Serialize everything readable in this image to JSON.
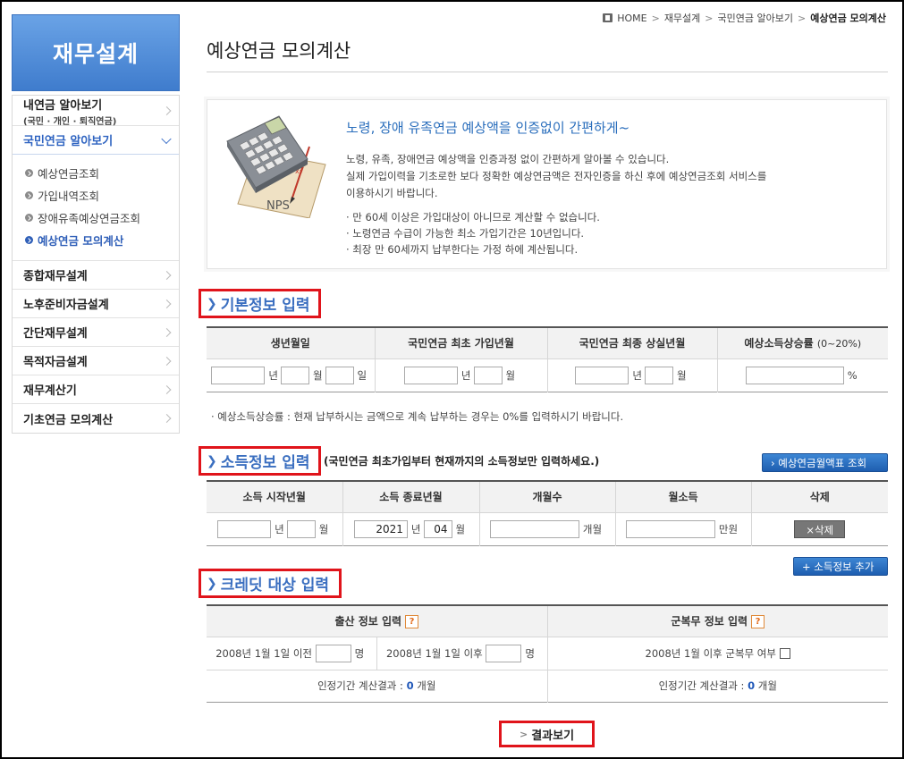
{
  "sidebar": {
    "title": "재무설계",
    "items": [
      {
        "label": "내연금 알아보기",
        "sub": "(국민 · 개인 · 퇴직연금)"
      },
      {
        "label": "국민연금 알아보기"
      }
    ],
    "submenu": [
      "예상연금조회",
      "가입내역조회",
      "장애유족예상연금조회",
      "예상연금 모의계산"
    ],
    "items_after": [
      "종합재무설계",
      "노후준비자금설계",
      "간단재무설계",
      "목적자금설계",
      "재무계산기",
      "기초연금 모의계산"
    ]
  },
  "breadcrumb": [
    "HOME",
    "재무설계",
    "국민연금 알아보기",
    "예상연금 모의계산"
  ],
  "page_title": "예상연금 모의계산",
  "intro": {
    "heading": "노령, 장애 유족연금 예상액을 인증없이 간편하게~",
    "p1": "노령, 유족, 장애연금 예상액을 인증과정 없이 간편하게 알아볼 수 있습니다.",
    "p2": "실제 가입이력을 기초로한 보다 정확한 예상연금액은 전자인증을 하신 후에 예상연금조회 서비스를",
    "p3": "이용하시기 바랍니다.",
    "b1": "· 만 60세 이상은 가입대상이 아니므로 계산할 수 없습니다.",
    "b2": "· 노령연금 수급이 가능한 최소 가입기간은 10년입니다.",
    "b3": "· 최장 만 60세까지 납부한다는 가정 하에 계산됩니다.",
    "illustration_text": "NPS"
  },
  "basic": {
    "title": "기본정보 입력",
    "headers": [
      "생년월일",
      "국민연금 최초 가입년월",
      "국민연금 최종 상실년월",
      "예상소득상승률"
    ],
    "rate_hint": "(0~20%)",
    "units": {
      "year": "년",
      "month": "월",
      "day": "일",
      "percent": "%"
    },
    "note": "· 예상소득상승률 : 현재 납부하시는 금액으로 계속 납부하는 경우는 0%를 입력하시기 바랍니다."
  },
  "income": {
    "title": "소득정보 입력",
    "subtitle": "(국민연금 최초가입부터 현재까지의 소득정보만 입력하세요.)",
    "lookup_button": "› 예상연금월액표 조회",
    "headers": [
      "소득 시작년월",
      "소득 종료년월",
      "개월수",
      "월소득",
      "삭제"
    ],
    "end_year": "2021",
    "end_month": "04",
    "units": {
      "year": "년",
      "month": "월",
      "months": "개월",
      "manwon": "만원"
    },
    "delete_button": "×삭제",
    "add_button": "+ 소득정보 추가"
  },
  "credit": {
    "title": "크레딧 대상 입력",
    "birth_header": "출산 정보 입력",
    "military_header": "군복무 정보 입력",
    "help": "?",
    "birth_before": "2008년 1월 1일 이전",
    "birth_after": "2008년 1월 1일 이후",
    "unit_person": "명",
    "military_label": "2008년 1월 이후 군복무 여부",
    "result_label": "인정기간 계산결과 :",
    "birth_result": "0",
    "military_result": "0",
    "months_unit": "개월"
  },
  "result_button": "결과보기"
}
